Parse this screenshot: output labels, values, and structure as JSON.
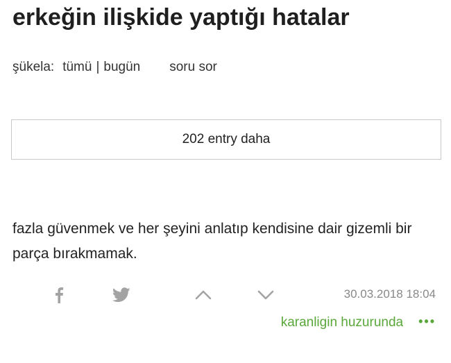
{
  "topic": {
    "title": "erkeğin ilişkide yaptığı hatalar"
  },
  "subnav": {
    "sukela_label": "şükela:",
    "all_link": "tümü",
    "separator": "|",
    "today_link": "bugün",
    "ask_link": "soru sor"
  },
  "more_entries": {
    "label": "202 entry daha"
  },
  "entry": {
    "content": "fazla güvenmek ve her şeyini anlatıp kendisine dair gizemli bir parça bırakmamak.",
    "date": "30.03.2018 18:04",
    "author": "karanligin huzurunda",
    "more_symbol": "•••",
    "icons": {
      "share_facebook": "facebook-icon",
      "share_twitter": "twitter-icon",
      "upvote": "chevron-up-icon",
      "downvote": "chevron-down-icon"
    }
  },
  "colors": {
    "accent_green": "#5aa73a",
    "icon_gray": "#9e9e9e",
    "border_gray": "#c9c9c9",
    "date_gray": "#888888"
  }
}
